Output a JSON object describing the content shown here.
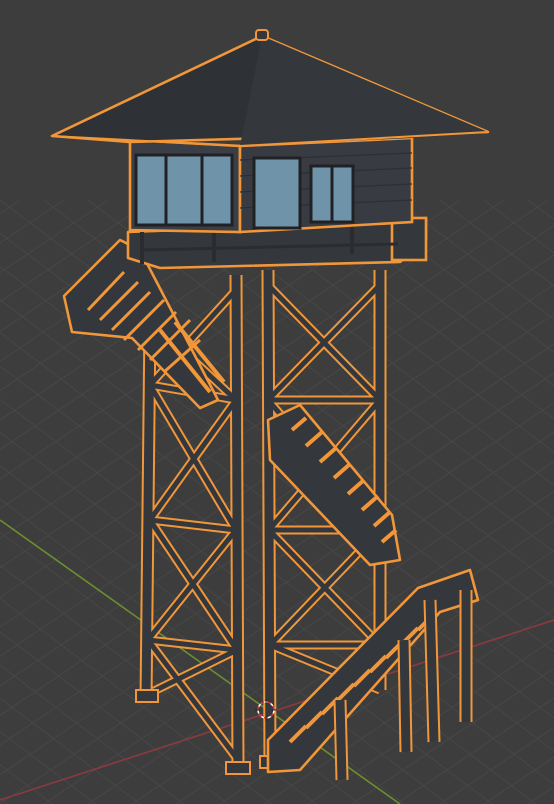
{
  "viewport": {
    "background": "#3d3d3d",
    "grid_color": "#474747",
    "x_axis_color": "#8b3a3f",
    "y_axis_color": "#6b8f2e",
    "selection_outline_color": "#f1973a"
  },
  "scene": {
    "selected_object": "fire-lookout-tower",
    "object_material_dark": "#34373c",
    "roof_color": "#2e3136",
    "window_glass_color": "#6f93a8",
    "cabin_wall_color": "#3b3e44"
  },
  "icons": {
    "origin": "3d-cursor-icon"
  }
}
